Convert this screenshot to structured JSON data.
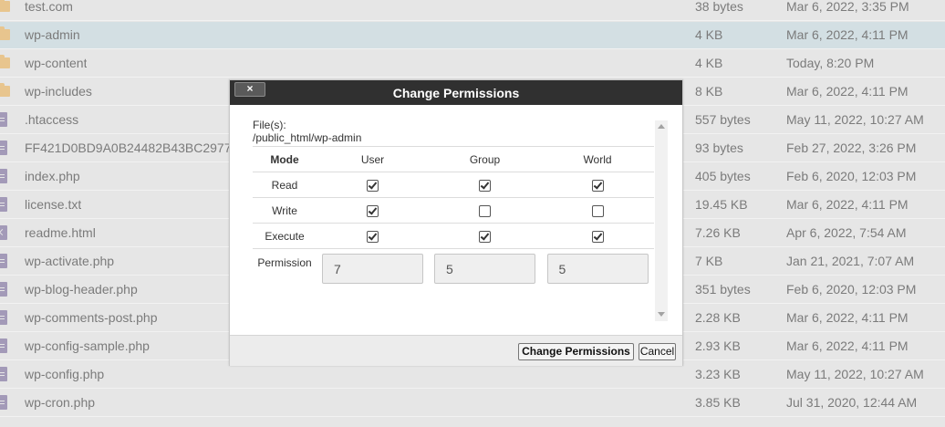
{
  "files": [
    {
      "name": "test.com",
      "size": "38 bytes",
      "date": "Mar 6, 2022, 3:35 PM",
      "icon": "folder-icon",
      "selected": false
    },
    {
      "name": "wp-admin",
      "size": "4 KB",
      "date": "Mar 6, 2022, 4:11 PM",
      "icon": "folder-icon",
      "selected": true
    },
    {
      "name": "wp-content",
      "size": "4 KB",
      "date": "Today, 8:20 PM",
      "icon": "folder-icon",
      "selected": false
    },
    {
      "name": "wp-includes",
      "size": "8 KB",
      "date": "Mar 6, 2022, 4:11 PM",
      "icon": "folder-icon",
      "selected": false
    },
    {
      "name": ".htaccess",
      "size": "557 bytes",
      "date": "May 11, 2022, 10:27 AM",
      "icon": "document-icon",
      "selected": false
    },
    {
      "name": "FF421D0BD9A0B24482B43BC2977",
      "size": "93 bytes",
      "date": "Feb 27, 2022, 3:26 PM",
      "icon": "document-icon",
      "selected": false
    },
    {
      "name": "index.php",
      "size": "405 bytes",
      "date": "Feb 6, 2020, 12:03 PM",
      "icon": "document-icon",
      "selected": false
    },
    {
      "name": "license.txt",
      "size": "19.45 KB",
      "date": "Mar 6, 2022, 4:11 PM",
      "icon": "document-icon",
      "selected": false
    },
    {
      "name": "readme.html",
      "size": "7.26 KB",
      "date": "Apr 6, 2022, 7:54 AM",
      "icon": "code-file-icon",
      "selected": false
    },
    {
      "name": "wp-activate.php",
      "size": "7 KB",
      "date": "Jan 21, 2021, 7:07 AM",
      "icon": "document-icon",
      "selected": false
    },
    {
      "name": "wp-blog-header.php",
      "size": "351 bytes",
      "date": "Feb 6, 2020, 12:03 PM",
      "icon": "document-icon",
      "selected": false
    },
    {
      "name": "wp-comments-post.php",
      "size": "2.28 KB",
      "date": "Mar 6, 2022, 4:11 PM",
      "icon": "document-icon",
      "selected": false
    },
    {
      "name": "wp-config-sample.php",
      "size": "2.93 KB",
      "date": "Mar 6, 2022, 4:11 PM",
      "icon": "document-icon",
      "selected": false
    },
    {
      "name": "wp-config.php",
      "size": "3.23 KB",
      "date": "May 11, 2022, 10:27 AM",
      "icon": "document-icon",
      "selected": false
    },
    {
      "name": "wp-cron.php",
      "size": "3.85 KB",
      "date": "Jul 31, 2020, 12:44 AM",
      "icon": "document-icon",
      "selected": false
    }
  ],
  "dialog": {
    "title": "Change Permissions",
    "close_label": "×",
    "files_label": "File(s):",
    "files_path": "/public_html/wp-admin",
    "headers": {
      "mode": "Mode",
      "user": "User",
      "group": "Group",
      "world": "World"
    },
    "rows": [
      {
        "label": "Read",
        "user": true,
        "group": true,
        "world": true
      },
      {
        "label": "Write",
        "user": true,
        "group": false,
        "world": false
      },
      {
        "label": "Execute",
        "user": true,
        "group": true,
        "world": true
      }
    ],
    "permission_label": "Permission",
    "permission_values": {
      "user": "7",
      "group": "5",
      "world": "5"
    },
    "submit_label": "Change Permissions",
    "cancel_label": "Cancel"
  },
  "colors": {
    "titlebar": "#303030",
    "selected_row": "#d3dfe3",
    "folder": "#e8c58e",
    "file": "#a39ab8"
  }
}
